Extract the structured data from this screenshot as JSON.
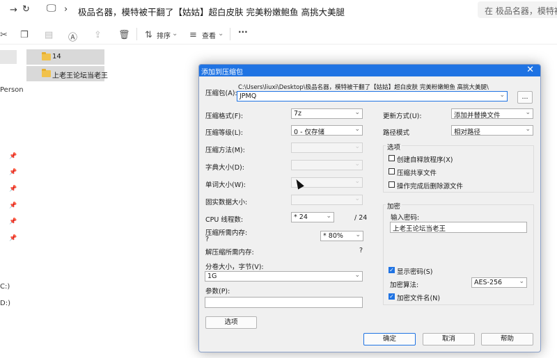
{
  "explorer": {
    "path": "极品名器，模特被干翻了【姑姑】超白皮肤 完美粉嫩鲍鱼 高挑大美腿",
    "search_placeholder": "在 极品名器，模特被干翻",
    "commands": {
      "sort": "排序",
      "view": "查看",
      "more": "···"
    },
    "nav": {
      "person": "Person",
      "drive_c": "C:)",
      "drive_d": "D:)"
    },
    "files": [
      "14",
      "上老王论坛当老王"
    ]
  },
  "dialog": {
    "title": "添加到压缩包",
    "archive_label": "压缩包(A):",
    "archive_dir": "C:\\Users\\liuxi\\Desktop\\极品名器，模特被干翻了【姑姑】超白皮肤 完美粉嫩鲍鱼 高挑大美腿\\",
    "archive_name": "JPMQ",
    "browse_label": "...",
    "left": {
      "format_label": "压缩格式(F):",
      "format_value": "7z",
      "level_label": "压缩等级(L):",
      "level_value": "0 - 仅存储",
      "method_label": "压缩方法(M):",
      "dict_label": "字典大小(D):",
      "word_label": "单词大小(W):",
      "solid_label": "固实数据大小:",
      "threads_label": "CPU 线程数:",
      "threads_value": "* 24",
      "threads_total": "/ 24",
      "mem_label": "压缩所需内存:",
      "mem_q": "?",
      "mem_value": "* 80%",
      "decomp_label": "解压缩所需内存:",
      "decomp_value": "?",
      "volume_label": "分卷大小，字节(V):",
      "volume_value": "1G",
      "params_label": "参数(P):",
      "params_value": "",
      "options_button": "选项"
    },
    "right": {
      "update_label": "更新方式(U):",
      "update_value": "添加并替换文件",
      "path_label": "路径模式",
      "path_value": "相对路径",
      "options_group": "选项",
      "opt_sfx": "创建自释放程序(X)",
      "opt_shared": "压缩共享文件",
      "opt_delete": "操作完成后删除源文件",
      "enc_group": "加密",
      "pwd_label": "输入密码:",
      "pwd_value": "上老王论坛当老王",
      "show_pwd": "显示密码(S)",
      "enc_method_label": "加密算法:",
      "enc_method_value": "AES-256",
      "enc_names": "加密文件名(N)"
    },
    "buttons": {
      "ok": "确定",
      "cancel": "取消",
      "help": "帮助"
    },
    "checks": {
      "sfx": false,
      "shared": false,
      "delete": false,
      "show_pwd": true,
      "enc_names": true
    }
  }
}
